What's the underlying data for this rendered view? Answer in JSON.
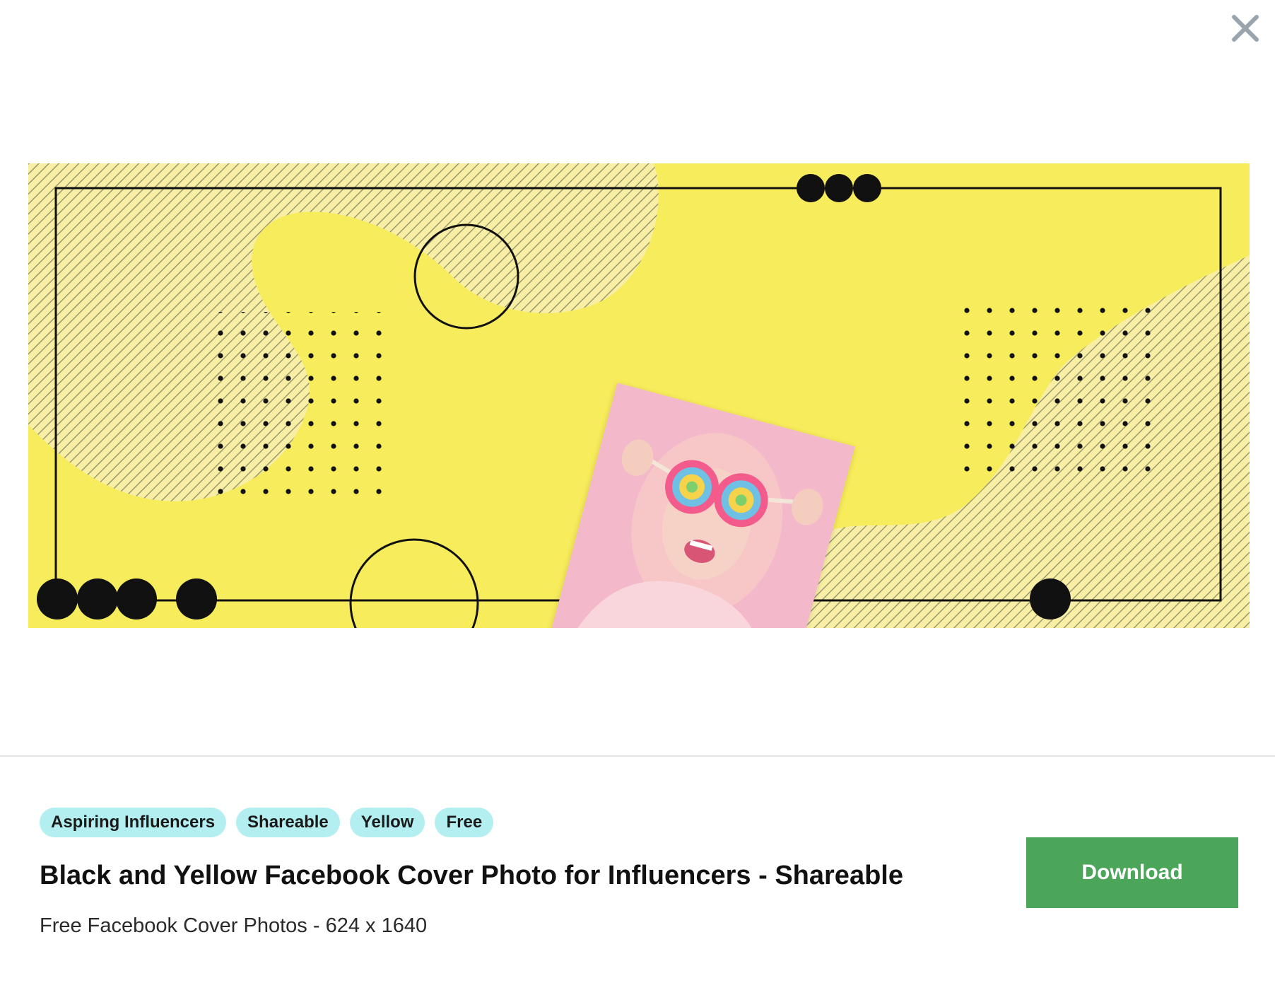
{
  "modal": {
    "close_icon": "close-icon",
    "preview_image": {
      "description_alt": "Black and Yellow Facebook Cover Photo for Influencers - Shareable",
      "colors": {
        "background": "#f7ec5b",
        "stripes": "#9a9a70",
        "ink": "#111111",
        "photo_pink": "#f2b4c8"
      }
    },
    "tags": [
      "Aspiring Influencers",
      "Shareable",
      "Yellow",
      "Free"
    ],
    "title": "Black and Yellow Facebook Cover Photo for Influencers - Shareable",
    "subtitle": "Free Facebook Cover Photos - 624 x 1640",
    "download_label": "Download",
    "colors": {
      "tag_bg": "#b3eff0",
      "download_bg": "#4ba65a",
      "close_icon": "#9aa4ad"
    }
  }
}
